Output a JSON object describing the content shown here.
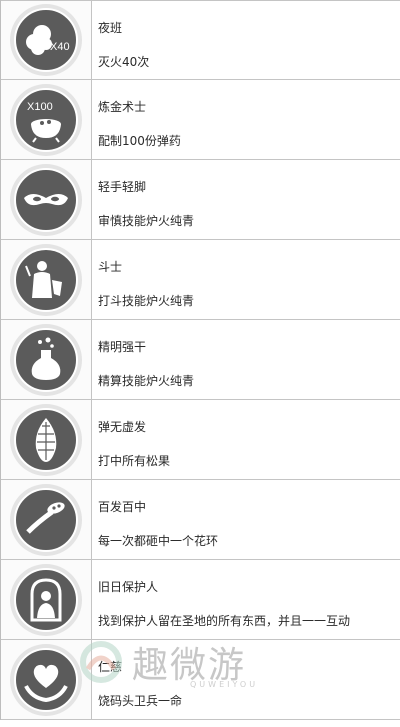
{
  "achievements": [
    {
      "title": "夜班",
      "desc": "灭火40次",
      "icon": "smoke-x40-icon",
      "badge_text": "X40"
    },
    {
      "title": "炼金术士",
      "desc": "配制100份弹药",
      "icon": "cauldron-x100-icon",
      "badge_text": "X100"
    },
    {
      "title": "轻手轻脚",
      "desc": "审慎技能炉火纯青",
      "icon": "mask-icon",
      "badge_text": ""
    },
    {
      "title": "斗士",
      "desc": "打斗技能炉火纯青",
      "icon": "warrior-icon",
      "badge_text": ""
    },
    {
      "title": "精明强干",
      "desc": "精算技能炉火纯青",
      "icon": "potion-icon",
      "badge_text": ""
    },
    {
      "title": "弹无虚发",
      "desc": "打中所有松果",
      "icon": "pinecone-icon",
      "badge_text": ""
    },
    {
      "title": "百发百中",
      "desc": "每一次都砸中一个花环",
      "icon": "wreath-icon",
      "badge_text": ""
    },
    {
      "title": "旧日保护人",
      "desc": "找到保护人留在圣地的所有东西，并且一一互动",
      "icon": "guardian-icon",
      "badge_text": ""
    },
    {
      "title": "仁慈",
      "desc": "饶码头卫兵一命",
      "icon": "heart-hands-icon",
      "badge_text": ""
    }
  ],
  "watermark": {
    "name": "趣微游",
    "sub": "QUWEIYOU"
  },
  "colors": {
    "badge_dark": "#5b5b5b",
    "badge_ring": "#e4e4e4",
    "border": "#c4c4c4"
  }
}
